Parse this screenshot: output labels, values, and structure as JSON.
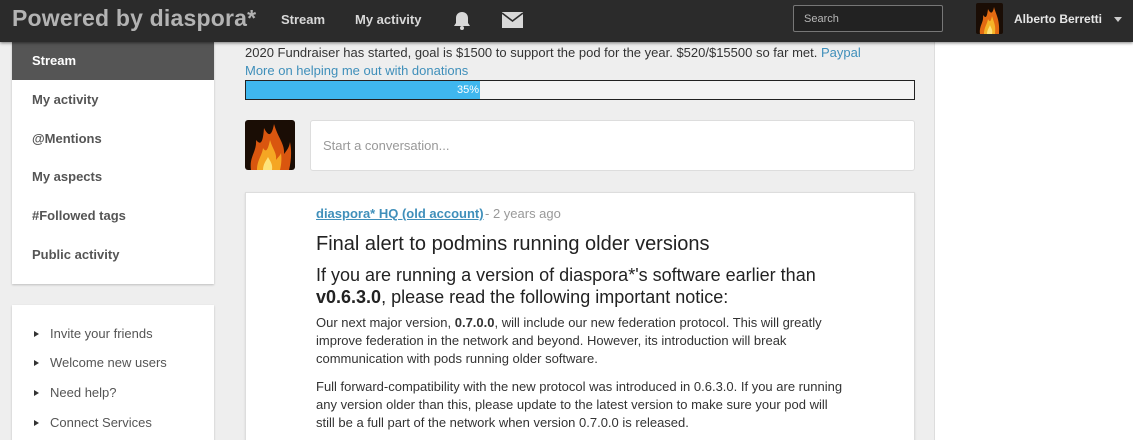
{
  "header": {
    "brand": "Powered by diaspora*",
    "nav_stream": "Stream",
    "nav_activity": "My activity",
    "search_placeholder": "Search",
    "username": "Alberto Berretti"
  },
  "sidebar": {
    "items": [
      {
        "label": "Stream"
      },
      {
        "label": "My activity"
      },
      {
        "label": "@Mentions"
      },
      {
        "label": "My aspects"
      },
      {
        "label": "#Followed tags"
      },
      {
        "label": "Public activity"
      }
    ]
  },
  "info": {
    "items": [
      {
        "label": "Invite your friends"
      },
      {
        "label": "Welcome new users"
      },
      {
        "label": "Need help?"
      },
      {
        "label": "Connect Services"
      }
    ]
  },
  "fundraiser": {
    "text": "2020 Fundraiser has started, goal is $1500 to support the pod for the year. $520/$15500 so far met.",
    "paypal": "Paypal",
    "more_link": "More on helping me out with donations",
    "progress_percent": 35,
    "progress_label": "35%"
  },
  "publisher": {
    "placeholder": "Start a conversation..."
  },
  "post": {
    "author": "diaspora* HQ (old account)",
    "time": "- 2 years ago",
    "title": "Final alert to podmins running older versions",
    "subtitle_pre": "If you are running a version of diaspora*'s software earlier than",
    "subtitle_version": "v0.6.3.0",
    "subtitle_post": ", please read the following important notice:",
    "p1_pre": "Our next major version,",
    "p1_version": "0.7.0.0",
    "p1_post": ", will include our new federation protocol. This will greatly improve federation in the network and beyond. However, its introduction will break communication with pods running older software.",
    "p2": "Full forward-compatibility with the new protocol was introduced in 0.6.3.0. If you are running any version older than this, please update to the latest version to make sure your pod will still be a full part of the network when version 0.7.0.0 is released."
  },
  "colors": {
    "header_bg": "#2b2b2b",
    "link": "#3f8fba",
    "progress": "#3fb7ee",
    "sidebar_active": "#555555"
  }
}
